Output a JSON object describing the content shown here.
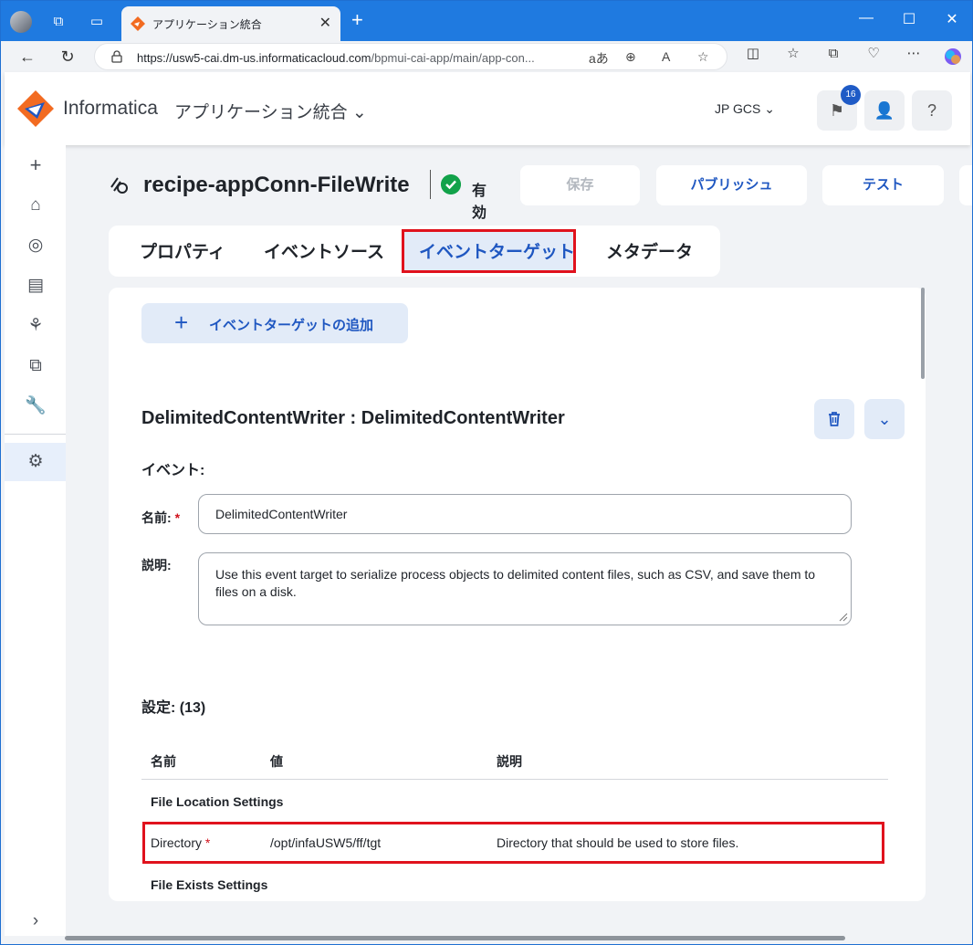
{
  "browser": {
    "tab_title": "アプリケーション統合",
    "url_host": "https://usw5-cai.dm-us.informaticacloud.com",
    "url_path": "/bpmui-cai-app/main/app-con...",
    "read_aloud": "aあ"
  },
  "header": {
    "brand": "Informatica",
    "app_name": "アプリケーション統合",
    "org": "JP GCS",
    "notification_count": "16"
  },
  "asset": {
    "title": "recipe-appConn-FileWrite",
    "status": "有効"
  },
  "actions": {
    "save": "保存",
    "publish": "パブリッシュ",
    "test": "テスト"
  },
  "tabs": [
    "プロパティ",
    "イベントソース",
    "イベントターゲット",
    "メタデータ"
  ],
  "panel": {
    "add_button": "イベントターゲットの追加",
    "target_title": "DelimitedContentWriter : DelimitedContentWriter",
    "event_label": "イベント:",
    "name_label": "名前:",
    "name_value": "DelimitedContentWriter",
    "desc_label": "説明:",
    "desc_value": "Use this event target to serialize process objects to delimited content files, such as CSV, and save them to files on a disk.",
    "settings_label": "設定: (13)",
    "columns": [
      "名前",
      "値",
      "説明"
    ],
    "group1": "File Location Settings",
    "row": {
      "name": "Directory",
      "value": "/opt/infaUSW5/ff/tgt",
      "description": "Directory that should be used to store files."
    },
    "group2": "File Exists Settings"
  },
  "colors": {
    "accent": "#1f57c1",
    "highlight": "#e0121d",
    "status_ok": "#12a24a"
  }
}
